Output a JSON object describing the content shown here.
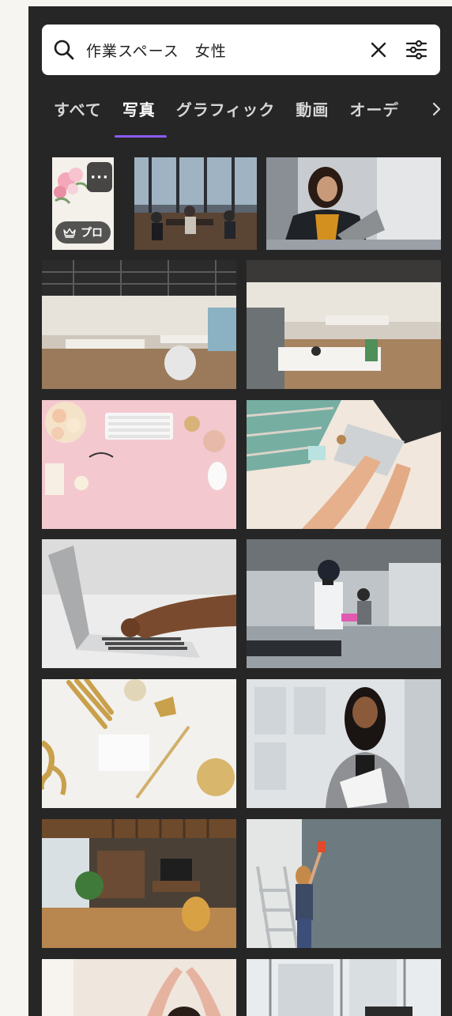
{
  "search": {
    "query": "作業スペース　女性"
  },
  "tabs": [
    {
      "label": "すべて",
      "active": false
    },
    {
      "label": "写真",
      "active": true
    },
    {
      "label": "グラフィック",
      "active": false
    },
    {
      "label": "動画",
      "active": false
    },
    {
      "label": "オーデ",
      "active": false
    }
  ],
  "first_result": {
    "pro_label": "プロ",
    "menu_label": "···"
  },
  "colors": {
    "accent": "#8b5cf6",
    "panel": "#262626"
  },
  "results": [
    {
      "name": "result-flowers-pro"
    },
    {
      "name": "result-cafe-workspace"
    },
    {
      "name": "result-woman-laptop"
    },
    {
      "name": "result-open-office-1"
    },
    {
      "name": "result-open-office-2"
    },
    {
      "name": "result-pink-desk-flatlay"
    },
    {
      "name": "result-hands-laptop-topdown"
    },
    {
      "name": "result-typing-laptop"
    },
    {
      "name": "result-kitchen-worker"
    },
    {
      "name": "result-gold-stationery"
    },
    {
      "name": "result-smiling-woman"
    },
    {
      "name": "result-wood-office"
    },
    {
      "name": "result-woman-painting-wall"
    },
    {
      "name": "result-woman-stretching"
    },
    {
      "name": "result-city-window"
    }
  ]
}
